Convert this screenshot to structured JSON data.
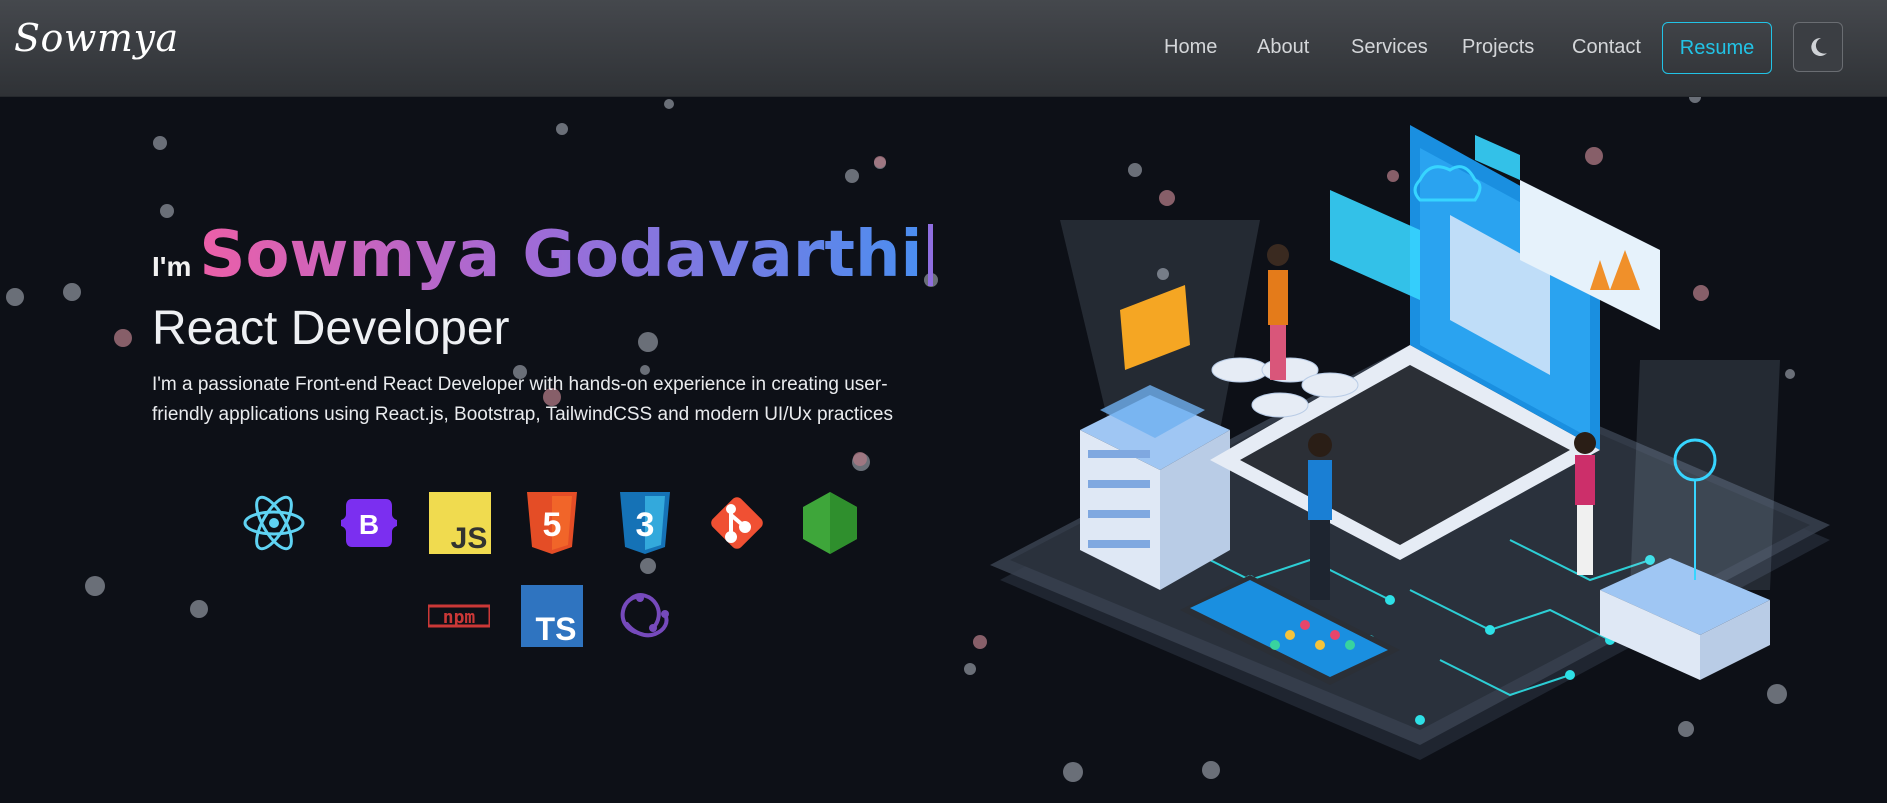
{
  "navbar": {
    "brand": "Sowmya",
    "links": [
      {
        "label": "Home"
      },
      {
        "label": "About"
      },
      {
        "label": "Services"
      },
      {
        "label": "Projects"
      },
      {
        "label": "Contact"
      }
    ],
    "resume_label": "Resume",
    "theme_icon": "moon-icon"
  },
  "hero": {
    "greeting": "I'm",
    "name": "Sowmya Godavarthi",
    "role": "React Developer",
    "description": "I'm a passionate Front-end React Developer with hands-on experience in creating user-friendly applications using React.js, Bootstrap, TailwindCSS and modern UI/Ux practices",
    "tech_icons": [
      {
        "name": "react-icon"
      },
      {
        "name": "bootstrap-icon",
        "label": "B"
      },
      {
        "name": "javascript-icon",
        "label": "JS"
      },
      {
        "name": "html5-icon",
        "label": "5"
      },
      {
        "name": "css3-icon",
        "label": "3"
      },
      {
        "name": "git-icon"
      },
      {
        "name": "nodejs-icon"
      },
      {
        "name": "npm-icon",
        "label": "npm"
      },
      {
        "name": "typescript-icon",
        "label": "TS"
      },
      {
        "name": "redux-icon"
      }
    ]
  },
  "colors": {
    "accent": "#22c3e6",
    "name_gradient_start": "#ec5fa8",
    "name_gradient_end": "#4b8ef0",
    "background": "#0d1017"
  }
}
